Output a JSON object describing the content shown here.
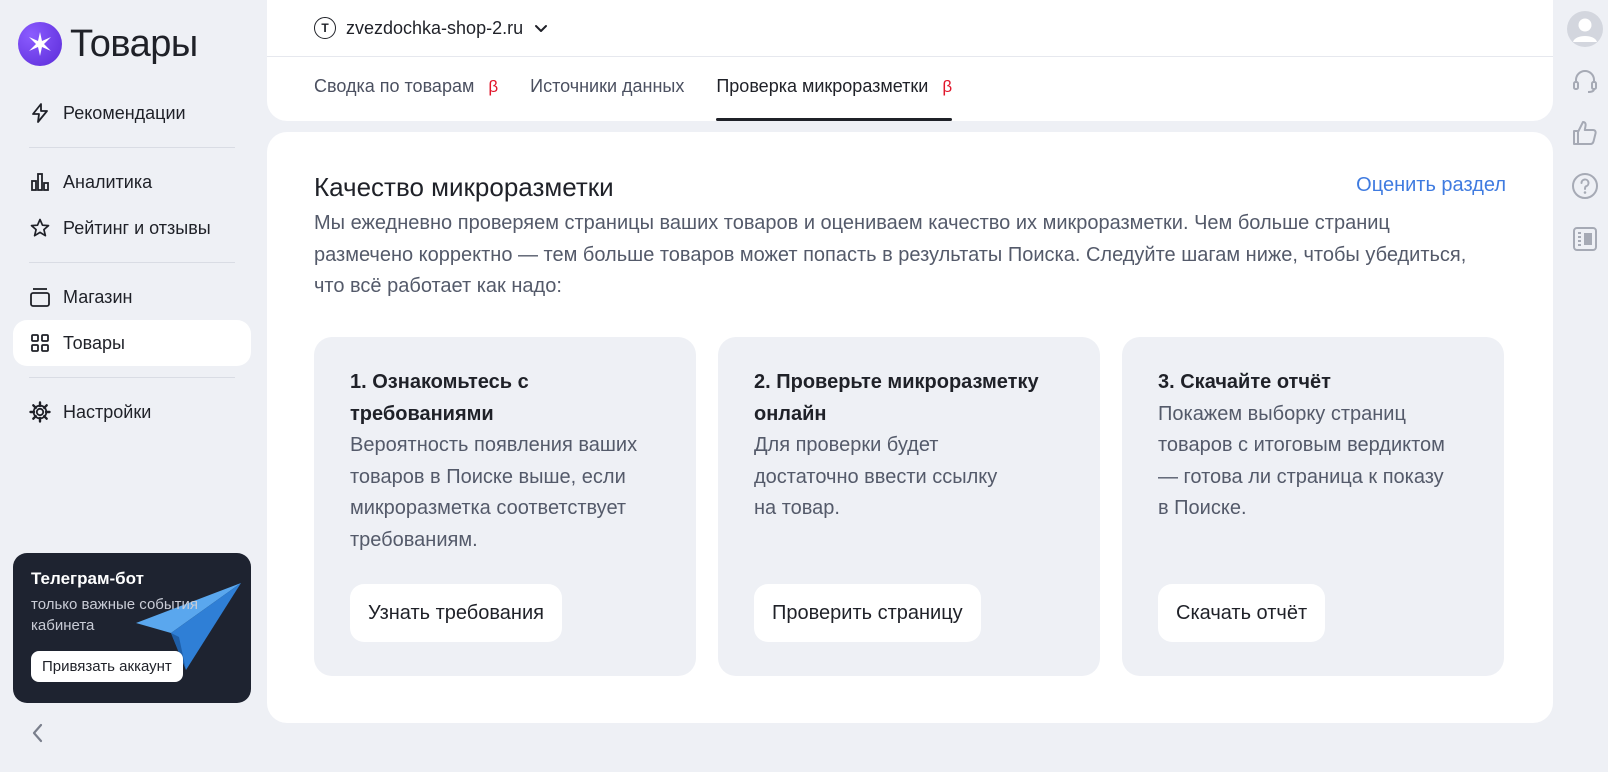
{
  "app": {
    "title": "Товары"
  },
  "sidebar": {
    "items": [
      {
        "label": "Рекомендации",
        "icon": "lightning-icon"
      },
      {
        "label": "Аналитика",
        "icon": "bar-chart-icon"
      },
      {
        "label": "Рейтинг и отзывы",
        "icon": "star-icon"
      },
      {
        "label": "Магазин",
        "icon": "store-icon"
      },
      {
        "label": "Товары",
        "icon": "grid-icon",
        "active": true
      },
      {
        "label": "Настройки",
        "icon": "gear-icon"
      }
    ],
    "telegram": {
      "title": "Телеграм-бот",
      "subtitle": "только важные события кабинета",
      "button": "Привязать аккаунт"
    }
  },
  "header": {
    "shop": "zvezdochka-shop-2.ru",
    "shop_icon_letter": "T",
    "tabs": [
      {
        "label": "Сводка по товарам",
        "beta": "β"
      },
      {
        "label": "Источники данных"
      },
      {
        "label": "Проверка микроразметки",
        "beta": "β",
        "active": true
      }
    ]
  },
  "main": {
    "title": "Качество микроразметки",
    "rate_link": "Оценить раздел",
    "description": "Мы ежедневно проверяем страницы ваших товаров и оцениваем качество их микроразметки. Чем больше страниц размечено корректно — тем больше товаров может попасть в результаты Поиска. Следуйте шагам ниже, чтобы убедиться, что всё работает как надо:",
    "cards": [
      {
        "title": "1. Ознакомьтесь с требованиями",
        "description": "Вероятность появления ваших товаров в Поиске выше, если микроразметка соответствует требованиям.",
        "button": "Узнать требования"
      },
      {
        "title": "2. Проверьте микроразметку онлайн",
        "description": "Для проверки будет достаточно ввести ссылку на товар.",
        "button": "Проверить страницу"
      },
      {
        "title": "3. Скачайте отчёт",
        "description": "Покажем выборку страниц товаров с итоговым вердиктом — готова ли страница к показу в Поиске.",
        "button": "Скачать отчёт"
      }
    ]
  },
  "colors": {
    "accent_link": "#3f7be0",
    "beta": "#e0162b",
    "logo": "#6a3df0"
  }
}
